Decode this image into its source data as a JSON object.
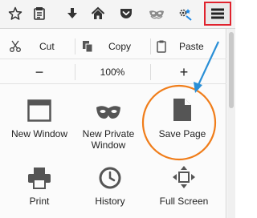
{
  "toolbar": {
    "icons": [
      "star-icon",
      "reading-list-icon",
      "download-icon",
      "home-icon",
      "pocket-icon",
      "mask-icon",
      "addon-icon",
      "menu-icon"
    ]
  },
  "menu": {
    "edit": {
      "cut": "Cut",
      "copy": "Copy",
      "paste": "Paste"
    },
    "zoom": {
      "minus": "−",
      "level": "100%",
      "plus": "+"
    },
    "tiles": {
      "new_window": "New Window",
      "new_private_window_line1": "New Private",
      "new_private_window_line2": "Window",
      "save_page": "Save Page",
      "print": "Print",
      "history": "History",
      "full_screen": "Full Screen"
    }
  },
  "annotation": {
    "highlight_color": "#e0232e",
    "circle_color": "#f07d1a",
    "arrow_color": "#2a8fd6"
  }
}
